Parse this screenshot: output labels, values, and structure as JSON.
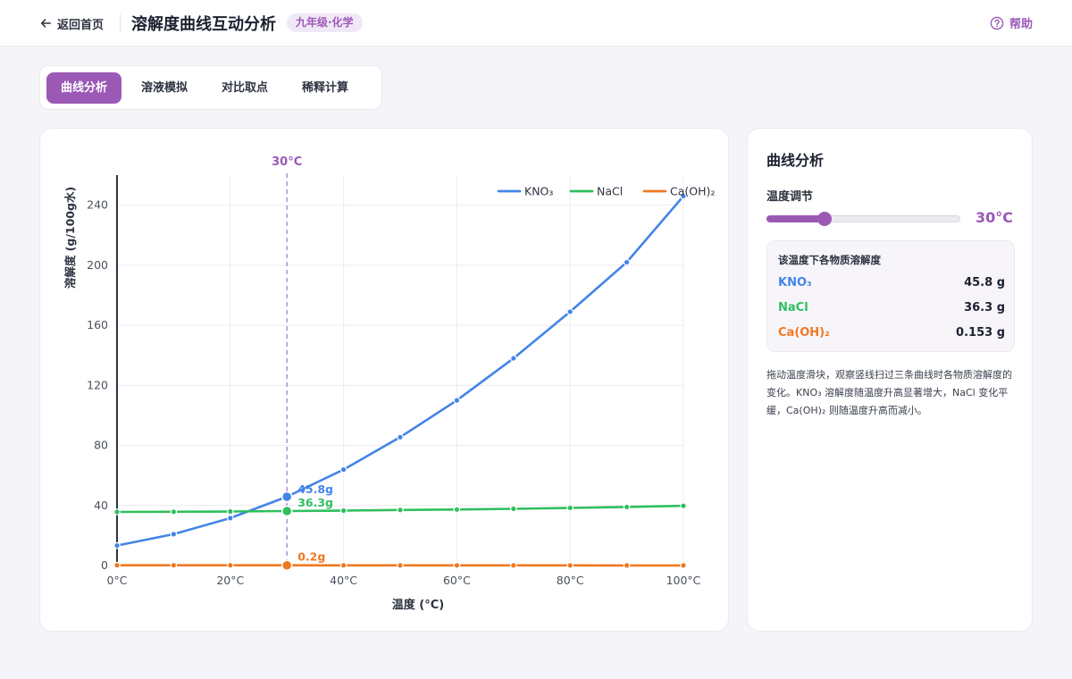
{
  "header": {
    "back_label": "返回首页",
    "title": "溶解度曲线互动分析",
    "badge": "九年级·化学",
    "help_label": "帮助"
  },
  "tabs": [
    {
      "label": "曲线分析",
      "active": true
    },
    {
      "label": "溶液模拟",
      "active": false
    },
    {
      "label": "对比取点",
      "active": false
    },
    {
      "label": "稀释计算",
      "active": false
    }
  ],
  "panel": {
    "title": "曲线分析",
    "temp_label": "温度调节",
    "temp_value": "30°C",
    "slider_fraction": 0.3,
    "box_title": "该温度下各物质溶解度",
    "rows": [
      {
        "name": "KNO₃",
        "value": "45.8 g",
        "color": "#4384e8"
      },
      {
        "name": "NaCl",
        "value": "36.3 g",
        "color": "#2fbf5e"
      },
      {
        "name": "Ca(OH)₂",
        "value": "0.153 g",
        "color": "#f07820"
      }
    ],
    "description": "拖动温度滑块，观察竖线扫过三条曲线时各物质溶解度的变化。KNO₃ 溶解度随温度升高显著增大，NaCl 变化平缓，Ca(OH)₂ 则随温度升高而减小。"
  },
  "chart_data": {
    "type": "line",
    "xlabel": "温度 (°C)",
    "ylabel": "溶解度 (g/100g水)",
    "xlim": [
      0,
      100
    ],
    "ylim": [
      0,
      260
    ],
    "x_ticks": [
      0,
      20,
      40,
      60,
      80,
      100
    ],
    "x_tick_labels": [
      "0°C",
      "20°C",
      "40°C",
      "60°C",
      "80°C",
      "100°C"
    ],
    "y_ticks": [
      0,
      40,
      80,
      120,
      160,
      200,
      240
    ],
    "y_tick_labels": [
      "0",
      "40",
      "80",
      "120",
      "160",
      "200",
      "240"
    ],
    "grid": true,
    "legend": "top-right",
    "x": [
      0,
      10,
      20,
      30,
      40,
      50,
      60,
      70,
      80,
      90,
      100
    ],
    "series": [
      {
        "name": "KNO₃",
        "color": "#4384e8",
        "values": [
          13.3,
          20.9,
          31.6,
          45.8,
          63.9,
          85.5,
          110,
          138,
          169,
          202,
          246
        ]
      },
      {
        "name": "NaCl",
        "color": "#2fbf5e",
        "values": [
          35.7,
          35.8,
          36.0,
          36.3,
          36.6,
          37.0,
          37.3,
          37.8,
          38.4,
          39.0,
          39.8
        ]
      },
      {
        "name": "Ca(OH)₂",
        "color": "#f07820",
        "values": [
          0.185,
          0.176,
          0.165,
          0.153,
          0.141,
          0.128,
          0.116,
          0.106,
          0.094,
          0.085,
          0.077
        ]
      }
    ],
    "marker_temp": 30,
    "marker_label": "30°C",
    "marker_points": [
      {
        "value": 45.8,
        "label": "45.8g"
      },
      {
        "value": 36.3,
        "label": "36.3g"
      },
      {
        "value": 0.153,
        "label": "0.2g"
      }
    ]
  }
}
